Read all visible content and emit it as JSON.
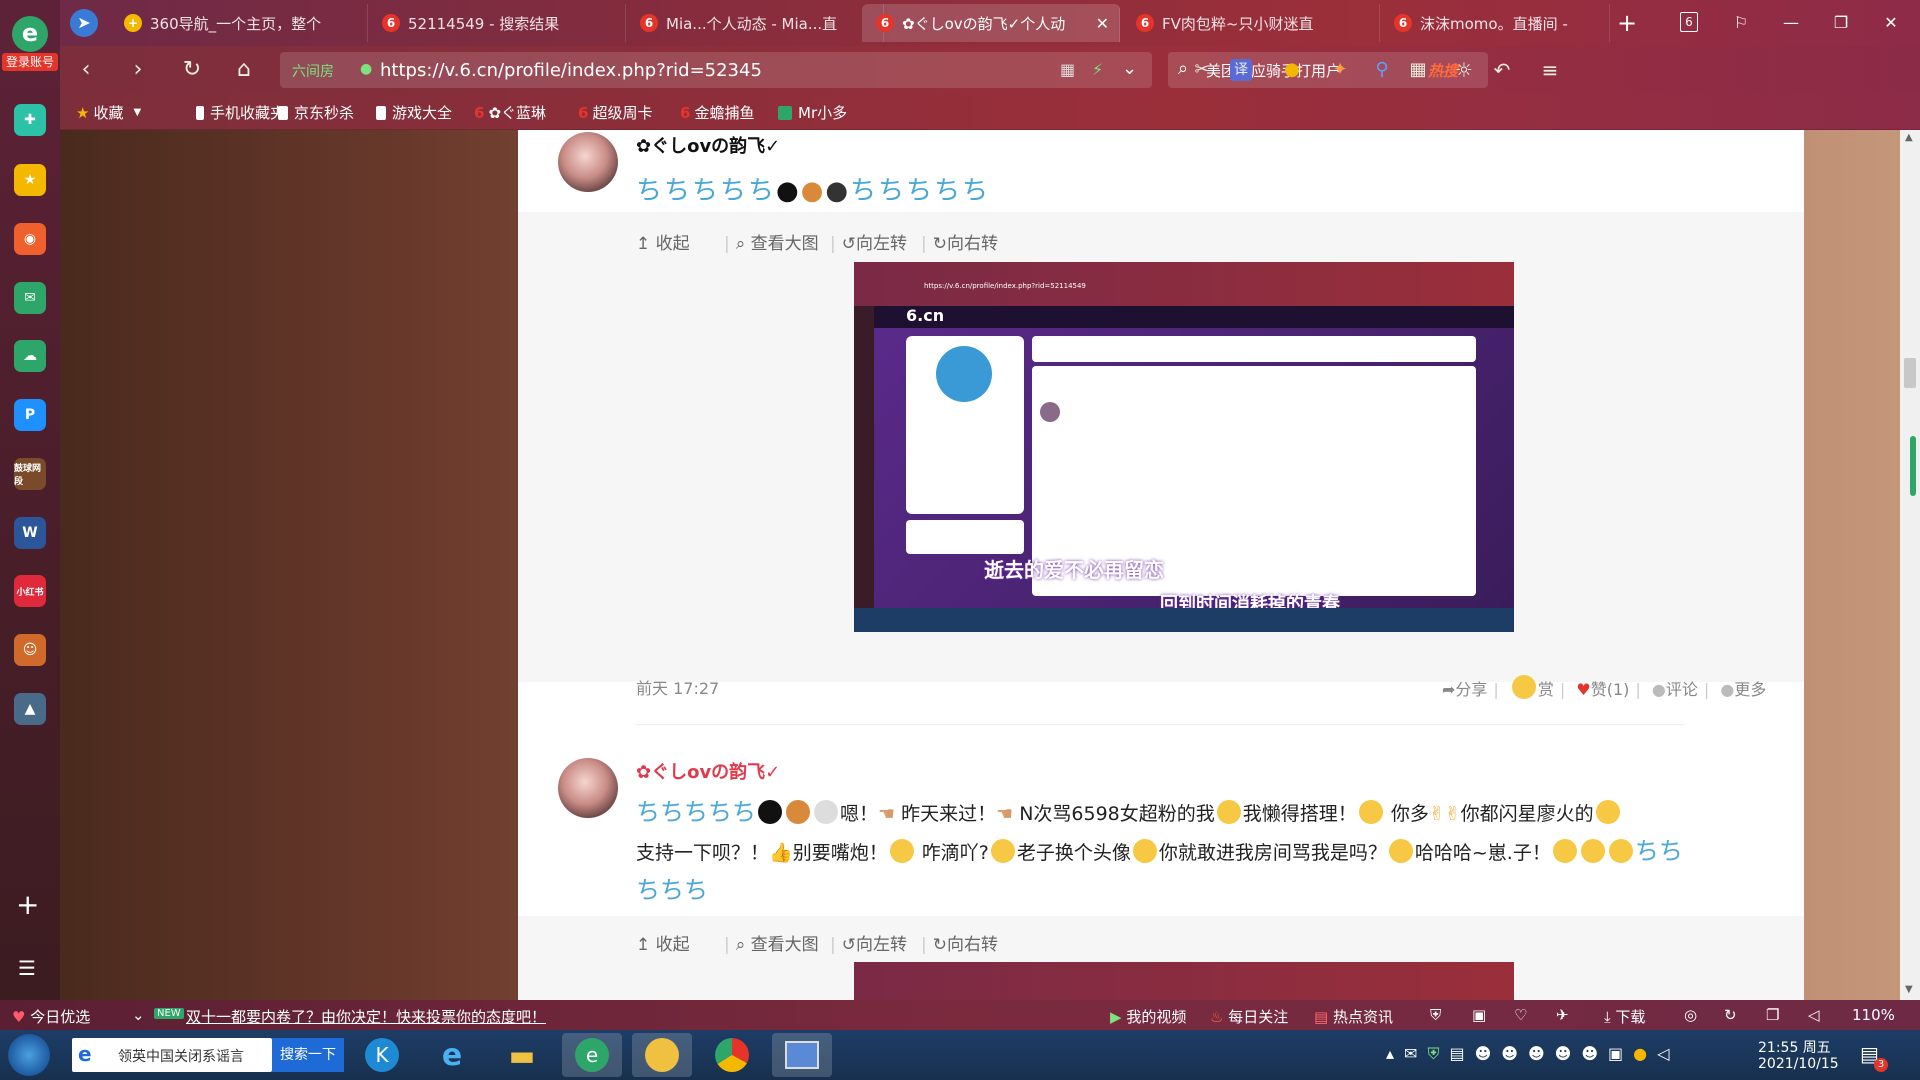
{
  "tabs": [
    {
      "label": "360导航_一个主页，整个",
      "color": "#f5b800"
    },
    {
      "label": "52114549 - 搜索结果",
      "color": "#e5352b"
    },
    {
      "label": "Mia...个人动态 - Mia...直",
      "color": "#e5352b"
    },
    {
      "label": "✿ぐしovの韵飞✓个人动",
      "color": "#e5352b",
      "active": true
    },
    {
      "label": "FV肉包粹~只小财迷直",
      "color": "#e5352b"
    },
    {
      "label": "沫沫momo。直播间 -",
      "color": "#e5352b"
    }
  ],
  "tab_counter": "6",
  "address": {
    "security_label": "六间房",
    "url": "https://v.6.cn/profile/index.php?rid=52345"
  },
  "search": {
    "text": "美团回应骑手打用户",
    "hot_label": "热搜"
  },
  "bookmarks": [
    {
      "label": "收藏",
      "color": "#f5b800"
    },
    {
      "label": "手机收藏夹",
      "color": "#ffffff"
    },
    {
      "label": "京东秒杀",
      "color": "#ffffff"
    },
    {
      "label": "游戏大全",
      "color": "#ffffff"
    },
    {
      "label": "✿ぐ蓝琳",
      "color": "#e5352b"
    },
    {
      "label": "超级周卡",
      "color": "#e5352b"
    },
    {
      "label": "金蟾捕鱼",
      "color": "#e5352b"
    },
    {
      "label": "Mr小多",
      "color": "#2ea66a"
    }
  ],
  "sidebar": {
    "login_label": "登录账号",
    "items": [
      {
        "icon": "plus-service-icon",
        "color": "#2cc2a8"
      },
      {
        "icon": "star-icon",
        "color": "#f5b800"
      },
      {
        "icon": "weibo-icon",
        "color": "#f0602c"
      },
      {
        "icon": "mail-icon",
        "color": "#2ea66a"
      },
      {
        "icon": "cloud-icon",
        "color": "#2ea66a"
      },
      {
        "icon": "p-app-icon",
        "color": "#1e90ff"
      },
      {
        "icon": "game-icon",
        "color": "#7a4a2a",
        "label": "鼓球网段"
      },
      {
        "icon": "word-icon",
        "color": "#2b579a"
      },
      {
        "icon": "xiaohongshu-icon",
        "color": "#e0293a",
        "label": "小红书"
      },
      {
        "icon": "avatar-game-icon",
        "color": "#d06a2a"
      },
      {
        "icon": "pubg-icon",
        "color": "#4a6a8a"
      }
    ]
  },
  "posts": [
    {
      "username": "✿ぐしovの韵飞✓",
      "actions": [
        "收起",
        "查看大图",
        "向左转",
        "向右转"
      ],
      "time": "前天 17:27",
      "footer": {
        "share": "分享",
        "reward": "赏",
        "like": "赞(1)",
        "comment": "评论",
        "more": "更多"
      },
      "screenshot": {
        "url": "https://v.6.cn/profile/index.php?rid=52114549",
        "logo": "6.cn",
        "lyric1": "逝去的爱不必再留恋",
        "lyric2": "回到时间消耗掉的青春"
      }
    },
    {
      "username": "✿ぐしovの韵飞✓",
      "text_parts": [
        "嗯！",
        " 昨天来过！",
        " N次骂6598女超粉的我",
        "我懒得搭理！",
        " 你多",
        "你都闪星廖火的",
        "支持一下呗？！",
        "别要嘴炮！",
        " 咋滴吖?",
        "老子换个头像",
        "你就敢进我房间骂我是吗？",
        "哈哈哈~崽.子！"
      ],
      "actions": [
        "收起",
        "查看大图",
        "向左转",
        "向右转"
      ]
    }
  ],
  "statusbar": {
    "today": "今日优选",
    "new_badge": "NEW",
    "news": "双十一都要内卷了？由你决定！快来投票你的态度吧！",
    "video": "我的视频",
    "daily": "每日关注",
    "hot": "热点资讯",
    "download": "下载",
    "zoom": "110%"
  },
  "taskbar": {
    "search_text": "领英中国关闭系谣言",
    "search_button": "搜索一下",
    "time": "21:55 周五",
    "date": "2021/10/15",
    "notification_count": "3"
  }
}
